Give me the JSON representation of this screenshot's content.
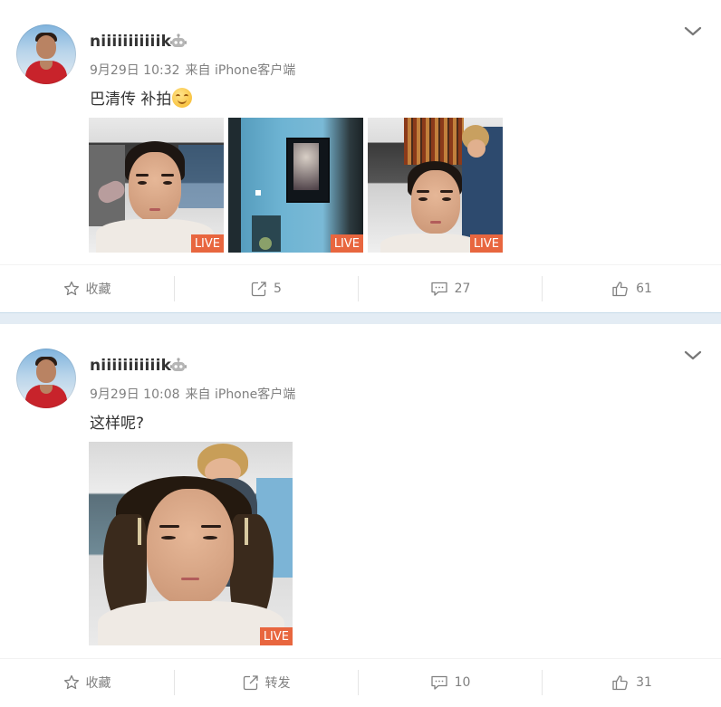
{
  "posts": [
    {
      "username": "niiiiiiiiiiik",
      "time": "9月29日 10:32",
      "source": "来自 iPhone客户端",
      "text": "巴清传 补拍",
      "live_badges": [
        "LIVE",
        "LIVE",
        "LIVE"
      ],
      "actions": {
        "favorite": "收藏",
        "repost": "5",
        "comment": "27",
        "like": "61"
      }
    },
    {
      "username": "niiiiiiiiiiik",
      "time": "9月29日 10:08",
      "source": "来自 iPhone客户端",
      "text": "这样呢?",
      "live_badges": [
        "LIVE"
      ],
      "actions": {
        "favorite": "收藏",
        "repost": "转发",
        "comment": "10",
        "like": "31"
      }
    }
  ],
  "icons": {
    "verified": "robot-badge-icon",
    "menu": "chevron-down-icon",
    "favorite": "star-icon",
    "repost": "share-arrow-icon",
    "comment": "comment-bubble-icon",
    "like": "thumbs-up-icon",
    "emoji": "smile-emoji-icon"
  },
  "colors": {
    "live_badge": "#e8663f",
    "separator": "#e3ecf4",
    "meta_text": "#808080"
  }
}
